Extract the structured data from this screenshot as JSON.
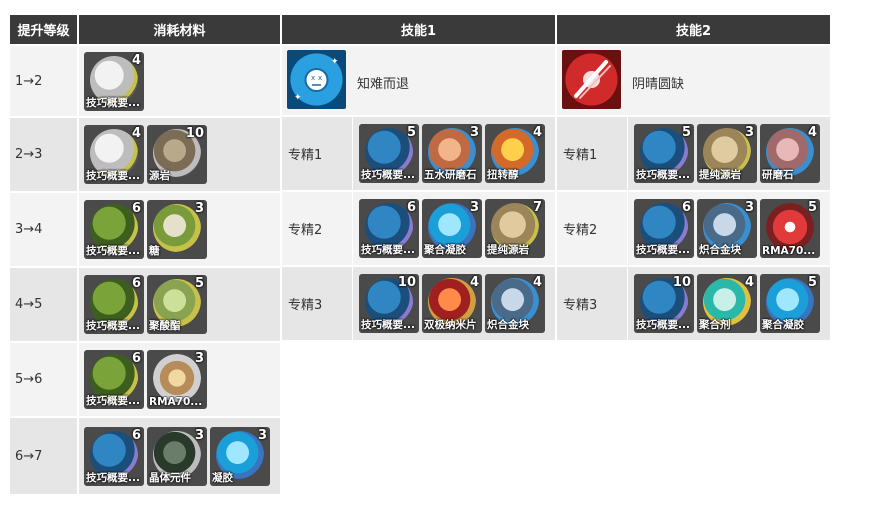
{
  "headers": {
    "level": "提升等级",
    "materials": "消耗材料",
    "skill1": "技能1",
    "skill2": "技能2"
  },
  "upgrades": [
    {
      "level": "1→2",
      "items": [
        {
          "name": "技巧概要...",
          "count": "4",
          "icon": "book-gray"
        }
      ]
    },
    {
      "level": "2→3",
      "items": [
        {
          "name": "技巧概要...",
          "count": "4",
          "icon": "book-gray"
        },
        {
          "name": "源岩",
          "count": "10",
          "icon": "rock-gray"
        }
      ]
    },
    {
      "level": "3→4",
      "items": [
        {
          "name": "技巧概要...",
          "count": "6",
          "icon": "book-green"
        },
        {
          "name": "糖",
          "count": "3",
          "icon": "sugar"
        }
      ]
    },
    {
      "level": "4→5",
      "items": [
        {
          "name": "技巧概要...",
          "count": "6",
          "icon": "book-green"
        },
        {
          "name": "聚酸酯",
          "count": "5",
          "icon": "ester"
        }
      ]
    },
    {
      "level": "5→6",
      "items": [
        {
          "name": "技巧概要...",
          "count": "6",
          "icon": "book-green"
        },
        {
          "name": "RMA70...",
          "count": "3",
          "icon": "rma"
        }
      ]
    },
    {
      "level": "6→7",
      "items": [
        {
          "name": "技巧概要...",
          "count": "6",
          "icon": "book-blue"
        },
        {
          "name": "晶体元件",
          "count": "3",
          "icon": "crystal"
        },
        {
          "name": "凝胶",
          "count": "3",
          "icon": "gel"
        }
      ]
    }
  ],
  "skill1": {
    "name": "知难而退",
    "icon": "skill-dizzy-icon",
    "masteries": [
      {
        "label": "专精1",
        "items": [
          {
            "name": "技巧概要...",
            "count": "5",
            "icon": "book-blue"
          },
          {
            "name": "五水研磨石",
            "count": "3",
            "icon": "grind"
          },
          {
            "name": "扭转醇",
            "count": "4",
            "icon": "twist"
          }
        ]
      },
      {
        "label": "专精2",
        "items": [
          {
            "name": "技巧概要...",
            "count": "6",
            "icon": "book-blue"
          },
          {
            "name": "聚合凝胶",
            "count": "3",
            "icon": "gel"
          },
          {
            "name": "提纯源岩",
            "count": "7",
            "icon": "rock-tan"
          }
        ]
      },
      {
        "label": "专精3",
        "items": [
          {
            "name": "技巧概要...",
            "count": "10",
            "icon": "book-blue"
          },
          {
            "name": "双极纳米片",
            "count": "4",
            "icon": "nano"
          },
          {
            "name": "炽合金块",
            "count": "4",
            "icon": "alloy"
          }
        ]
      }
    ]
  },
  "skill2": {
    "name": "阴晴圆缺",
    "icon": "skill-slash-icon",
    "masteries": [
      {
        "label": "专精1",
        "items": [
          {
            "name": "技巧概要...",
            "count": "5",
            "icon": "book-blue"
          },
          {
            "name": "提纯源岩",
            "count": "3",
            "icon": "rock-tan"
          },
          {
            "name": "研磨石",
            "count": "4",
            "icon": "grindstone"
          }
        ]
      },
      {
        "label": "专精2",
        "items": [
          {
            "name": "技巧概要...",
            "count": "6",
            "icon": "book-blue"
          },
          {
            "name": "炽合金块",
            "count": "3",
            "icon": "alloy"
          },
          {
            "name": "RMA70...",
            "count": "5",
            "icon": "rma-red"
          }
        ]
      },
      {
        "label": "专精3",
        "items": [
          {
            "name": "技巧概要...",
            "count": "10",
            "icon": "book-blue"
          },
          {
            "name": "聚合剂",
            "count": "4",
            "icon": "polyagent"
          },
          {
            "name": "聚合凝胶",
            "count": "5",
            "icon": "gel"
          }
        ]
      }
    ]
  }
}
